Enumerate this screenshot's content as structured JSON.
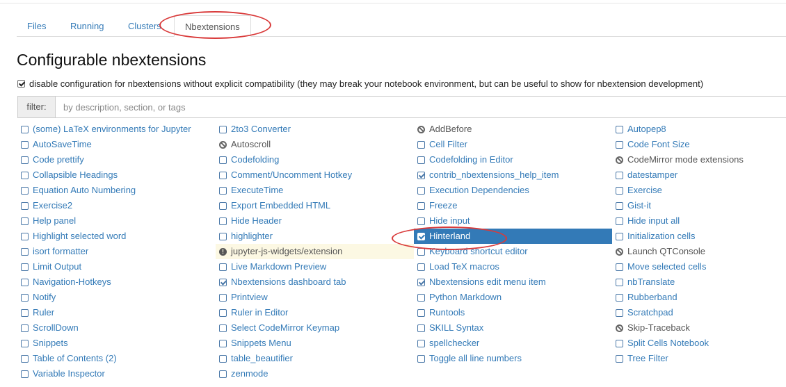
{
  "tabs": [
    {
      "label": "Files",
      "active": false
    },
    {
      "label": "Running",
      "active": false
    },
    {
      "label": "Clusters",
      "active": false
    },
    {
      "label": "Nbextensions",
      "active": true
    }
  ],
  "page_title": "Configurable nbextensions",
  "compat_checkbox": {
    "checked": true,
    "label": "disable configuration for nbextensions without explicit compatibility (they may break your notebook environment, but can be useful to show for nbextension development)"
  },
  "filter": {
    "label": "filter:",
    "placeholder": "by description, section, or tags",
    "value": ""
  },
  "extensions": [
    [
      {
        "name": "(some) LaTeX environments for Jupyter",
        "state": "unchecked"
      },
      {
        "name": "AutoSaveTime",
        "state": "unchecked"
      },
      {
        "name": "Code prettify",
        "state": "unchecked"
      },
      {
        "name": "Collapsible Headings",
        "state": "unchecked"
      },
      {
        "name": "Equation Auto Numbering",
        "state": "unchecked"
      },
      {
        "name": "Exercise2",
        "state": "unchecked"
      },
      {
        "name": "Help panel",
        "state": "unchecked"
      },
      {
        "name": "Highlight selected word",
        "state": "unchecked"
      },
      {
        "name": "isort formatter",
        "state": "unchecked"
      },
      {
        "name": "Limit Output",
        "state": "unchecked"
      },
      {
        "name": "Navigation-Hotkeys",
        "state": "unchecked"
      },
      {
        "name": "Notify",
        "state": "unchecked"
      },
      {
        "name": "Ruler",
        "state": "unchecked"
      },
      {
        "name": "ScrollDown",
        "state": "unchecked"
      },
      {
        "name": "Snippets",
        "state": "unchecked"
      },
      {
        "name": "Table of Contents (2)",
        "state": "unchecked"
      },
      {
        "name": "Variable Inspector",
        "state": "unchecked"
      }
    ],
    [
      {
        "name": "2to3 Converter",
        "state": "unchecked"
      },
      {
        "name": "Autoscroll",
        "state": "disabled"
      },
      {
        "name": "Codefolding",
        "state": "unchecked"
      },
      {
        "name": "Comment/Uncomment Hotkey",
        "state": "unchecked"
      },
      {
        "name": "ExecuteTime",
        "state": "unchecked"
      },
      {
        "name": "Export Embedded HTML",
        "state": "unchecked"
      },
      {
        "name": "Hide Header",
        "state": "unchecked"
      },
      {
        "name": "highlighter",
        "state": "unchecked"
      },
      {
        "name": "jupyter-js-widgets/extension",
        "state": "warning"
      },
      {
        "name": "Live Markdown Preview",
        "state": "unchecked"
      },
      {
        "name": "Nbextensions dashboard tab",
        "state": "checked"
      },
      {
        "name": "Printview",
        "state": "unchecked"
      },
      {
        "name": "Ruler in Editor",
        "state": "unchecked"
      },
      {
        "name": "Select CodeMirror Keymap",
        "state": "unchecked"
      },
      {
        "name": "Snippets Menu",
        "state": "unchecked"
      },
      {
        "name": "table_beautifier",
        "state": "unchecked"
      },
      {
        "name": "zenmode",
        "state": "unchecked"
      }
    ],
    [
      {
        "name": "AddBefore",
        "state": "disabled"
      },
      {
        "name": "Cell Filter",
        "state": "unchecked"
      },
      {
        "name": "Codefolding in Editor",
        "state": "unchecked"
      },
      {
        "name": "contrib_nbextensions_help_item",
        "state": "checked"
      },
      {
        "name": "Execution Dependencies",
        "state": "unchecked"
      },
      {
        "name": "Freeze",
        "state": "unchecked"
      },
      {
        "name": "Hide input",
        "state": "unchecked"
      },
      {
        "name": "Hinterland",
        "state": "checked",
        "selected": true
      },
      {
        "name": "Keyboard shortcut editor",
        "state": "unchecked"
      },
      {
        "name": "Load TeX macros",
        "state": "unchecked"
      },
      {
        "name": "Nbextensions edit menu item",
        "state": "checked"
      },
      {
        "name": "Python Markdown",
        "state": "unchecked"
      },
      {
        "name": "Runtools",
        "state": "unchecked"
      },
      {
        "name": "SKILL Syntax",
        "state": "unchecked"
      },
      {
        "name": "spellchecker",
        "state": "unchecked"
      },
      {
        "name": "Toggle all line numbers",
        "state": "unchecked"
      }
    ],
    [
      {
        "name": "Autopep8",
        "state": "unchecked"
      },
      {
        "name": "Code Font Size",
        "state": "unchecked"
      },
      {
        "name": "CodeMirror mode extensions",
        "state": "disabled"
      },
      {
        "name": "datestamper",
        "state": "unchecked"
      },
      {
        "name": "Exercise",
        "state": "unchecked"
      },
      {
        "name": "Gist-it",
        "state": "unchecked"
      },
      {
        "name": "Hide input all",
        "state": "unchecked"
      },
      {
        "name": "Initialization cells",
        "state": "unchecked"
      },
      {
        "name": "Launch QTConsole",
        "state": "disabled"
      },
      {
        "name": "Move selected cells",
        "state": "unchecked"
      },
      {
        "name": "nbTranslate",
        "state": "unchecked"
      },
      {
        "name": "Rubberband",
        "state": "unchecked"
      },
      {
        "name": "Scratchpad",
        "state": "unchecked"
      },
      {
        "name": "Skip-Traceback",
        "state": "disabled"
      },
      {
        "name": "Split Cells Notebook",
        "state": "unchecked"
      },
      {
        "name": "Tree Filter",
        "state": "unchecked"
      }
    ]
  ],
  "colors": {
    "link": "#337ab7",
    "selected_bg": "#337ab7",
    "warning_bg": "#fcf8e3",
    "annotation": "#d93a3a"
  }
}
